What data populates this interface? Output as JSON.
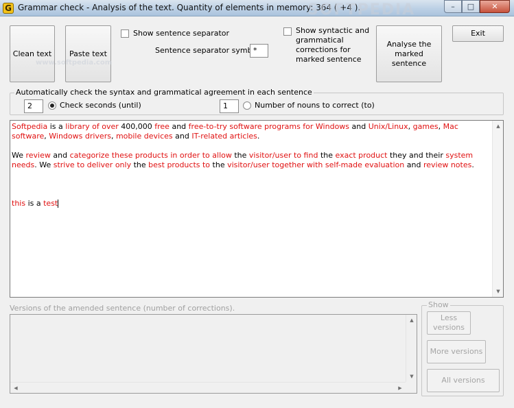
{
  "window": {
    "title": "Grammar check - Analysis of the text. Quantity of elements in memory: 364 ( +4 ).",
    "minimize_glyph": "–",
    "maximize_glyph": "□",
    "close_glyph": "✕",
    "app_icon_letter": "G"
  },
  "toolbar": {
    "clean_text_label": "Clean text",
    "paste_text_label": "Paste text",
    "show_separator_label": "Show sentence separator",
    "separator_symbol_label": "Sentence separator symbol:",
    "separator_symbol_value": "*",
    "show_corrections_label": "Show syntactic and grammatical corrections for marked sentence",
    "analyse_button_label": "Analyse the marked sentence",
    "exit_label": "Exit"
  },
  "auto_check": {
    "group_title": "Automatically check the syntax and grammatical agreement in each sentence",
    "seconds_value": "2",
    "seconds_label": "Check seconds (until)",
    "nouns_value": "1",
    "nouns_label": "Number of nouns to correct (to)"
  },
  "editor": {
    "paragraphs": [
      [
        {
          "t": "Softpedia",
          "r": true
        },
        {
          "t": " is a ",
          "r": false
        },
        {
          "t": "library of over",
          "r": true
        },
        {
          "t": " 400,000 ",
          "r": false
        },
        {
          "t": "free",
          "r": true
        },
        {
          "t": " and ",
          "r": false
        },
        {
          "t": "free-to-try software programs for Windows",
          "r": true
        },
        {
          "t": " and ",
          "r": false
        },
        {
          "t": "Unix/Linux",
          "r": true
        },
        {
          "t": ", ",
          "r": false
        },
        {
          "t": "games",
          "r": true
        },
        {
          "t": ", ",
          "r": false
        },
        {
          "t": "Mac software",
          "r": true
        },
        {
          "t": ", ",
          "r": false
        },
        {
          "t": "Windows drivers",
          "r": true
        },
        {
          "t": ", ",
          "r": false
        },
        {
          "t": "mobile devices",
          "r": true
        },
        {
          "t": " and ",
          "r": false
        },
        {
          "t": "IT-related articles",
          "r": true
        },
        {
          "t": ".",
          "r": false
        }
      ],
      [
        {
          "t": "We ",
          "r": false
        },
        {
          "t": "review",
          "r": true
        },
        {
          "t": " and ",
          "r": false
        },
        {
          "t": "categorize these products in order to allow",
          "r": true
        },
        {
          "t": " the ",
          "r": false
        },
        {
          "t": "visitor/user to find",
          "r": true
        },
        {
          "t": " the ",
          "r": false
        },
        {
          "t": "exact product",
          "r": true
        },
        {
          "t": " they and their ",
          "r": false
        },
        {
          "t": "system needs",
          "r": true
        },
        {
          "t": ". We ",
          "r": false
        },
        {
          "t": "strive to deliver only",
          "r": true
        },
        {
          "t": " the ",
          "r": false
        },
        {
          "t": "best products to",
          "r": true
        },
        {
          "t": " the ",
          "r": false
        },
        {
          "t": "visitor/user together with self-made evaluation",
          "r": true
        },
        {
          "t": " and ",
          "r": false
        },
        {
          "t": "review notes",
          "r": true
        },
        {
          "t": ".",
          "r": false
        }
      ],
      [],
      [
        {
          "t": "this",
          "r": true
        },
        {
          "t": " is a ",
          "r": false
        },
        {
          "t": "test",
          "r": true
        }
      ]
    ]
  },
  "versions": {
    "label": "Versions of the amended sentence (number of corrections).",
    "show_group_title": "Show",
    "less_label": "Less versions",
    "more_label": "More versions",
    "all_label": "All versions"
  },
  "watermark": {
    "logo_text": "SOFTPEDIA",
    "url_text": "www.softpedia.com"
  },
  "colors": {
    "highlight": "#e01010",
    "disabled_text": "#a4a4a4"
  }
}
